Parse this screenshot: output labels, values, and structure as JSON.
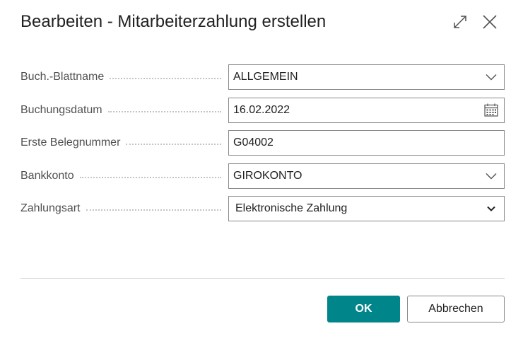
{
  "dialog": {
    "title": "Bearbeiten - Mitarbeiterzahlung erstellen",
    "expand_icon": "expand-icon",
    "close_icon": "close-icon"
  },
  "form": {
    "fields": [
      {
        "label": "Buch.-Blattname",
        "value": "ALLGEMEIN",
        "control": "dropdown",
        "icon": "chevron-down-icon"
      },
      {
        "label": "Buchungsdatum",
        "value": "16.02.2022",
        "control": "date",
        "icon": "calendar-icon"
      },
      {
        "label": "Erste Belegnummer",
        "value": "G04002",
        "control": "text"
      },
      {
        "label": "Bankkonto",
        "value": "GIROKONTO",
        "control": "dropdown",
        "icon": "chevron-down-icon"
      },
      {
        "label": "Zahlungsart",
        "value": "Elektronische Zahlung",
        "control": "select",
        "icon": "chevron-down-icon"
      }
    ]
  },
  "actions": {
    "ok_label": "OK",
    "cancel_label": "Abbrechen"
  },
  "colors": {
    "primary": "#00858a",
    "border": "#8a8886",
    "label": "#505050",
    "text": "#212121"
  }
}
